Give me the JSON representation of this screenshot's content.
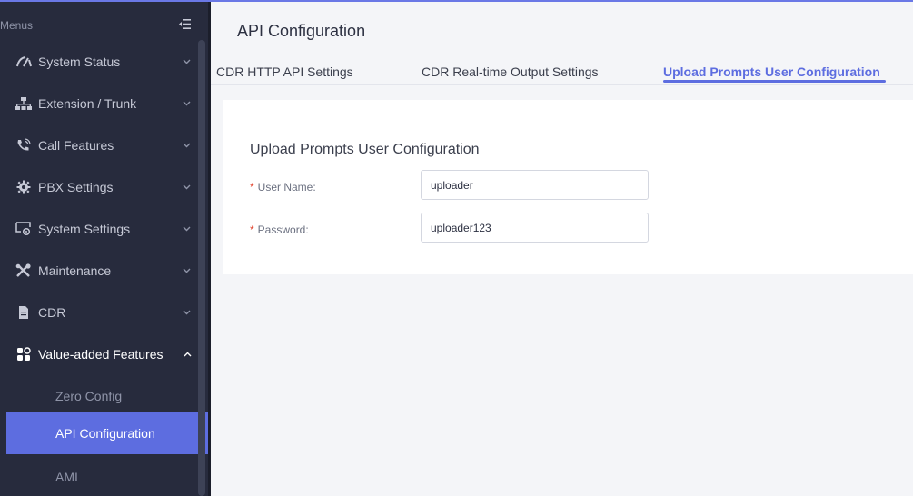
{
  "sidebar": {
    "menus_label": "Menus",
    "items": [
      {
        "label": "System Status",
        "icon": "gauge-icon"
      },
      {
        "label": "Extension / Trunk",
        "icon": "network-icon"
      },
      {
        "label": "Call Features",
        "icon": "phone-icon"
      },
      {
        "label": "PBX Settings",
        "icon": "gear-icon"
      },
      {
        "label": "System Settings",
        "icon": "monitor-gear-icon"
      },
      {
        "label": "Maintenance",
        "icon": "tools-icon"
      },
      {
        "label": "CDR",
        "icon": "document-icon"
      },
      {
        "label": "Value-added Features",
        "icon": "grid-icon"
      }
    ],
    "subitems": [
      {
        "label": "Zero Config"
      },
      {
        "label": "API Configuration"
      },
      {
        "label": "AMI"
      }
    ]
  },
  "main": {
    "title": "API Configuration",
    "tabs": [
      {
        "label": "CDR HTTP API Settings"
      },
      {
        "label": "CDR Real-time Output Settings"
      },
      {
        "label": "Upload Prompts User Configuration"
      }
    ],
    "section_title": "Upload Prompts User Configuration",
    "fields": {
      "username": {
        "label": "User Name",
        "value": "uploader",
        "required_mark": "*",
        "suffix": ":"
      },
      "password": {
        "label": "Password",
        "value": "uploader123",
        "required_mark": "*",
        "suffix": ":"
      }
    }
  },
  "colors": {
    "accent": "#5d6de0",
    "sidebar_bg": "#272b3d",
    "required": "#e2452f"
  }
}
